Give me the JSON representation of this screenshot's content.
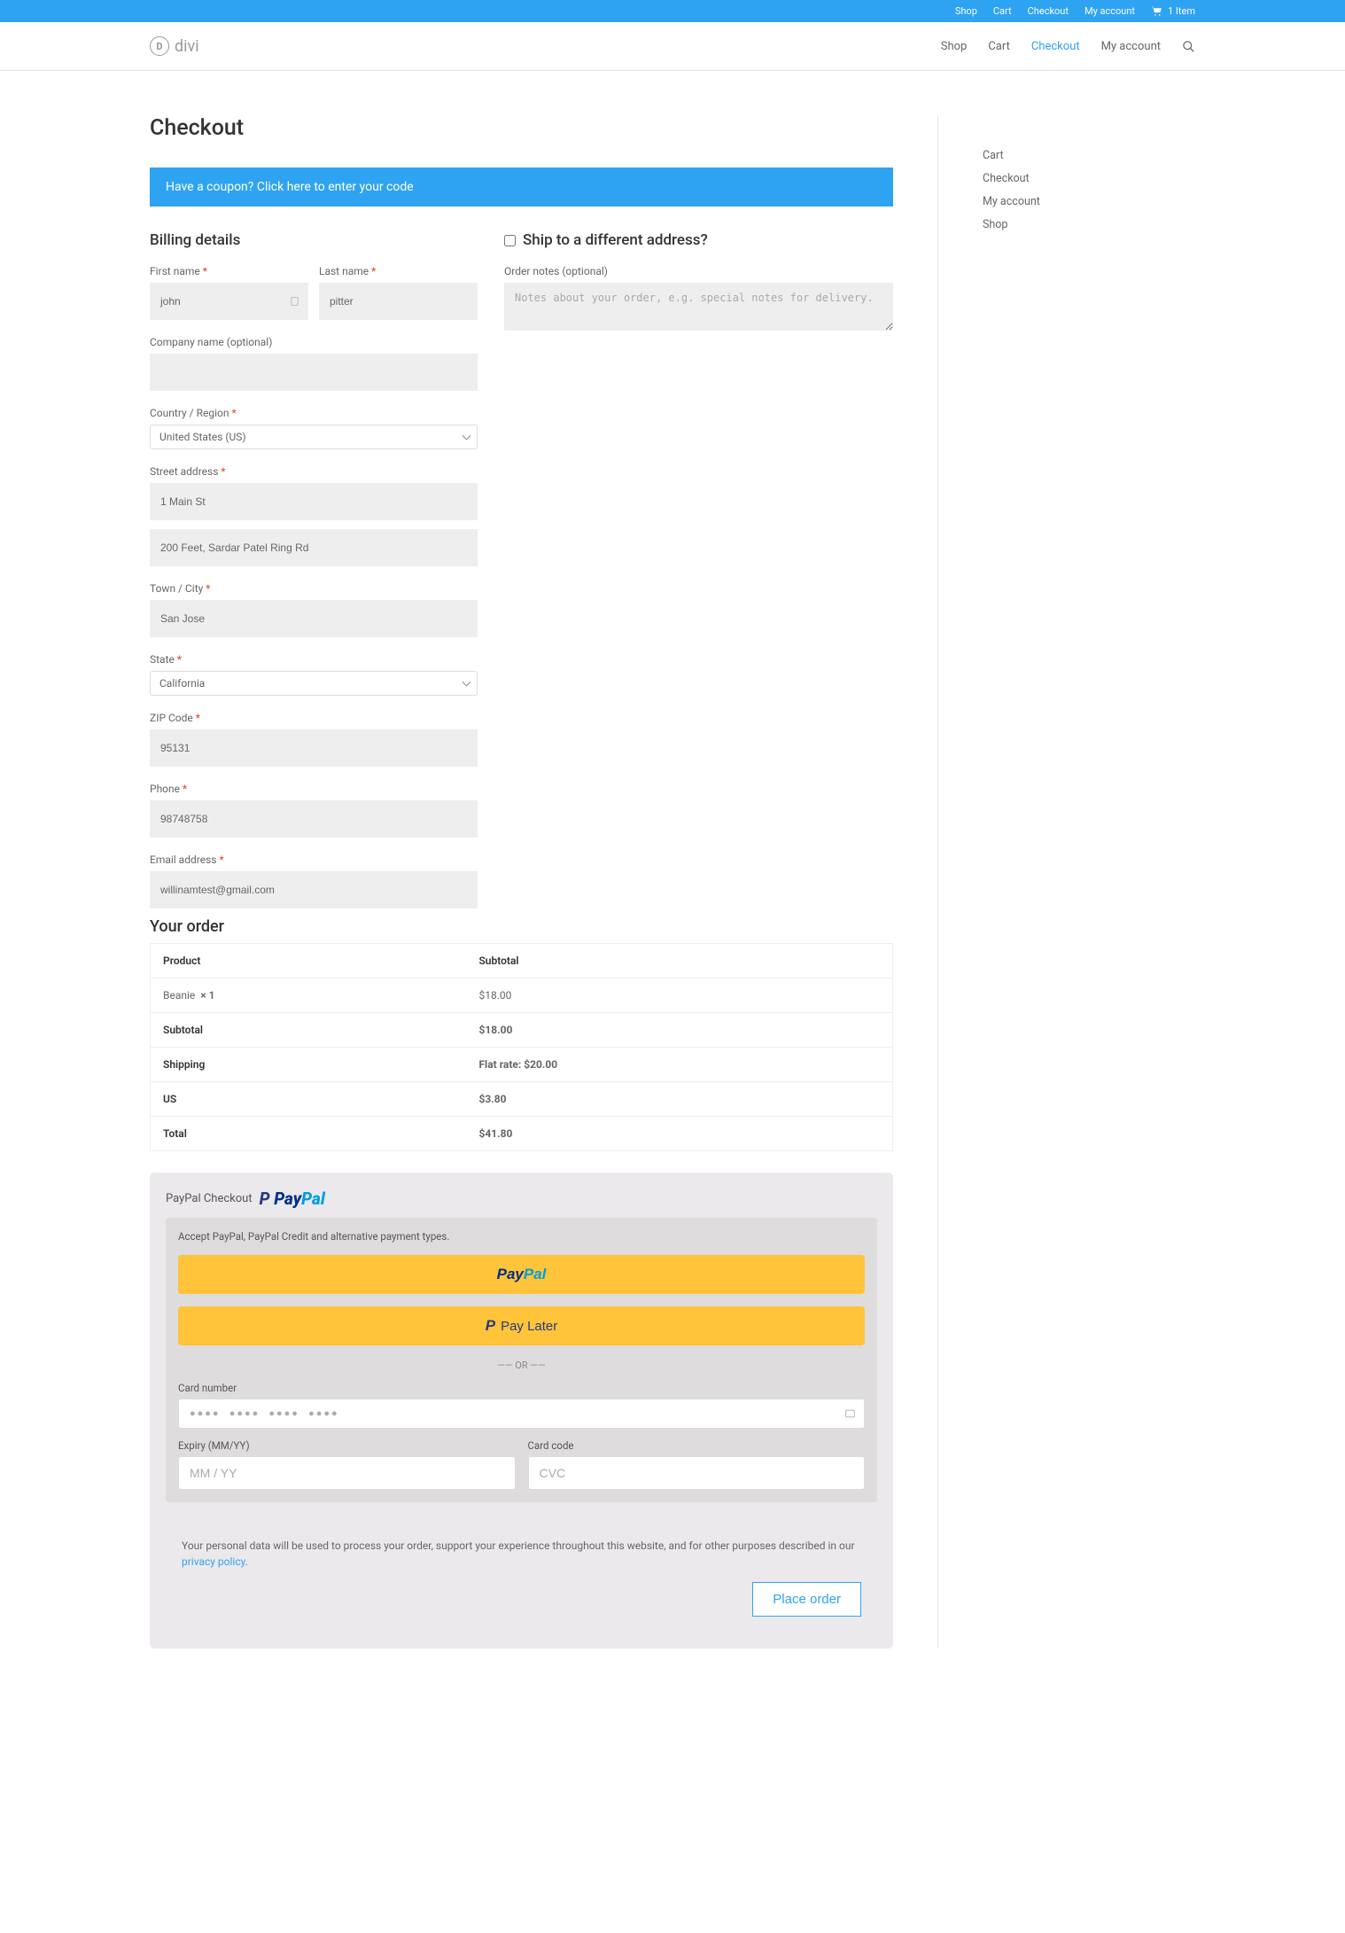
{
  "topbar": {
    "links": [
      "Shop",
      "Cart",
      "Checkout",
      "My account"
    ],
    "cart_count": "1 Item"
  },
  "mainnav": {
    "logo_text": "divi",
    "links": [
      {
        "label": "Shop",
        "active": false
      },
      {
        "label": "Cart",
        "active": false
      },
      {
        "label": "Checkout",
        "active": true
      },
      {
        "label": "My account",
        "active": false
      }
    ]
  },
  "sidebar": {
    "items": [
      "Cart",
      "Checkout",
      "My account",
      "Shop"
    ]
  },
  "page": {
    "title": "Checkout",
    "coupon_notice": "Have a coupon? Click here to enter your code"
  },
  "billing": {
    "heading": "Billing details",
    "fields": {
      "first_name": {
        "label": "First name",
        "value": "john"
      },
      "last_name": {
        "label": "Last name",
        "value": "pitter"
      },
      "company": {
        "label": "Company name (optional)",
        "value": ""
      },
      "country": {
        "label": "Country / Region",
        "value": "United States (US)"
      },
      "street": {
        "label": "Street address",
        "value": "1 Main St"
      },
      "street2": {
        "value": "200 Feet, Sardar Patel Ring Rd"
      },
      "city": {
        "label": "Town / City",
        "value": "San Jose"
      },
      "state": {
        "label": "State",
        "value": "California"
      },
      "zip": {
        "label": "ZIP Code",
        "value": "95131"
      },
      "phone": {
        "label": "Phone",
        "value": "98748758"
      },
      "email": {
        "label": "Email address",
        "value": "willinamtest@gmail.com"
      }
    }
  },
  "shipping": {
    "heading": "Ship to a different address?",
    "notes_label": "Order notes (optional)",
    "notes_placeholder": "Notes about your order, e.g. special notes for delivery."
  },
  "order": {
    "heading": "Your order",
    "headers": {
      "product": "Product",
      "subtotal": "Subtotal"
    },
    "items": [
      {
        "name": "Beanie",
        "qty": "× 1",
        "subtotal": "$18.00"
      }
    ],
    "subtotal": {
      "label": "Subtotal",
      "value": "$18.00"
    },
    "shipping": {
      "label": "Shipping",
      "value": "Flat rate: $20.00"
    },
    "tax": {
      "label": "US",
      "value": "$3.80"
    },
    "total": {
      "label": "Total",
      "value": "$41.80"
    }
  },
  "payment": {
    "method_label": "PayPal Checkout",
    "desc": "Accept PayPal, PayPal Credit and alternative payment types.",
    "paylater_label": "Pay Later",
    "or_sep": "——  OR  ——",
    "card_number": {
      "label": "Card number",
      "placeholder": "●●●●  ●●●●  ●●●●  ●●●●"
    },
    "expiry": {
      "label": "Expiry (MM/YY)",
      "placeholder": "MM / YY"
    },
    "cvc": {
      "label": "Card code",
      "placeholder": "CVC"
    }
  },
  "privacy": {
    "text_a": "Your personal data will be used to process your order, support your experience throughout this website, and for other purposes described in our ",
    "link": "privacy policy",
    "text_b": "."
  },
  "place_order": "Place order"
}
